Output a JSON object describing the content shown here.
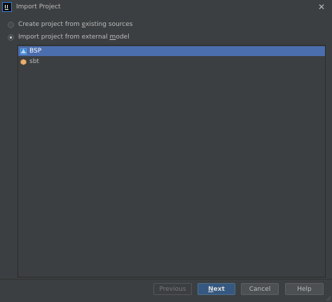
{
  "window": {
    "title": "Import Project"
  },
  "options": [
    {
      "label_pre": "Create project from ",
      "label_mnemonic": "e",
      "label_post": "xisting sources",
      "checked": false
    },
    {
      "label_pre": "Import project from external ",
      "label_mnemonic": "m",
      "label_post": "odel",
      "checked": true
    }
  ],
  "models": [
    {
      "label": "BSP",
      "icon": "bsp-icon",
      "selected": true
    },
    {
      "label": "sbt",
      "icon": "sbt-icon",
      "selected": false
    }
  ],
  "buttons": {
    "previous": "Previous",
    "next_mnemonic": "N",
    "next_rest": "ext",
    "cancel": "Cancel",
    "help": "Help"
  },
  "colors": {
    "background": "#3c3f41",
    "selection": "#4b6eaf",
    "primary_button": "#365880"
  }
}
